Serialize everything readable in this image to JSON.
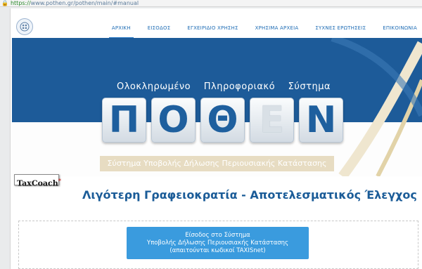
{
  "browser": {
    "url_scheme": "https://",
    "url_host": "www.pothen.gr",
    "url_path": "/pothen/main/#manual"
  },
  "nav": {
    "items": [
      {
        "label": "ΑΡΧΙΚΗ",
        "active": true
      },
      {
        "label": "ΕΙΣΟΔΟΣ"
      },
      {
        "label": "ΕΓΧΕΙΡΙΔΙΟ ΧΡΗΣΗΣ"
      },
      {
        "label": "ΧΡΗΣΙΜΑ ΑΡΧΕΙΑ"
      },
      {
        "label": "ΣΥΧΝΕΣ ΕΡΩΤΗΣΕΙΣ"
      },
      {
        "label": "ΕΠΙΚΟΙΝΩΝΙΑ"
      }
    ]
  },
  "hero": {
    "subtitle": "Ολοκληρωμένο Πληροφοριακό Σύστημα",
    "letters": [
      "Π",
      "Ο",
      "Θ",
      "Ε",
      "Ν"
    ],
    "tagline": "Σύστημα Υποβολής Δήλωσης Περιουσιακής Κατάστασης"
  },
  "badge": {
    "name": "TaxCoach",
    "mark": "*"
  },
  "motto": "Λιγότερη Γραφειοκρατία - Αποτελεσματικός Έλεγχος",
  "login": {
    "line1": "Είσοδος στο Σύστημα",
    "line2": "Υποβολής Δήλωσης Περιουσιακής Κατάστασης",
    "line3": "(απαιτούνται κωδικοί TAXISnet)"
  },
  "colors": {
    "brand_blue": "#1d5b99",
    "accent_beige": "#e7dcc2",
    "button_blue": "#3a9bde"
  }
}
